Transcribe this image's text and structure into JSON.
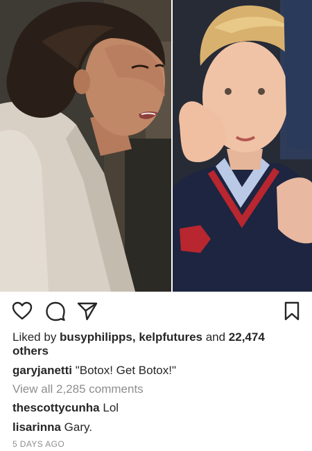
{
  "post": {
    "likes": {
      "prefix": "Liked by ",
      "user1": "busyphilipps",
      "sep": ", ",
      "user2": "kelpfutures",
      "and": " and ",
      "count": "22,474 others"
    },
    "caption": {
      "username": "garyjanetti",
      "text": " \"Botox! Get Botox!\""
    },
    "view_all_comments": "View all 2,285 comments",
    "comments": [
      {
        "username": "thescottycunha",
        "text": " Lol"
      },
      {
        "username": "lisarinna",
        "text": " Gary."
      }
    ],
    "timestamp": "5 DAYS AGO"
  },
  "icons": {
    "like": "heart-icon",
    "comment": "comment-bubble-icon",
    "share": "paper-plane-icon",
    "save": "bookmark-icon"
  },
  "colors": {
    "text": "#262626",
    "muted": "#8e8e8e",
    "background": "#ffffff"
  }
}
